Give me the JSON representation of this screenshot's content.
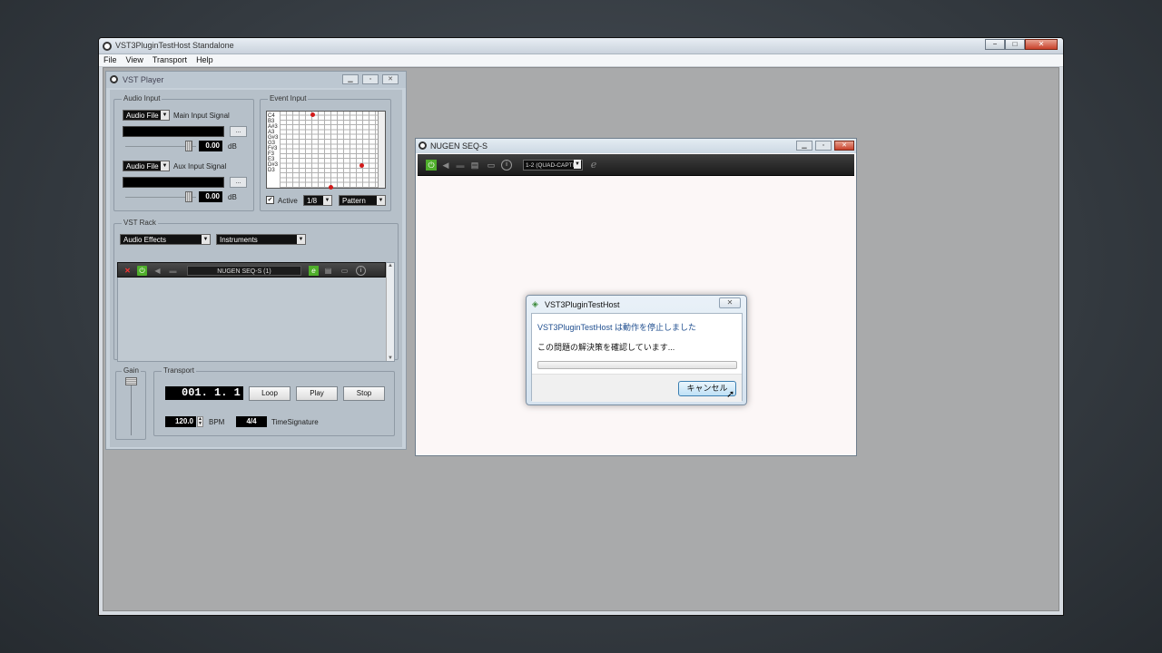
{
  "main_window": {
    "title": "VST3PluginTestHost Standalone",
    "buttons": {
      "minimize": "−",
      "maximize": "□",
      "close": "✕"
    },
    "menu": [
      "File",
      "View",
      "Transport",
      "Help"
    ]
  },
  "vst_player": {
    "title": "VST Player",
    "audio_input": {
      "label": "Audio Input",
      "main": {
        "source": "Audio File",
        "label": "Main Input Signal",
        "browse": "...",
        "value": "0.00",
        "unit": "dB"
      },
      "aux": {
        "source": "Audio File",
        "label": "Aux Input Signal",
        "browse": "...",
        "value": "0.00",
        "unit": "dB"
      }
    },
    "event_input": {
      "label": "Event Input",
      "notes": [
        "C4",
        "B3",
        "A#3",
        "A3",
        "G#3",
        "G3",
        "F#3",
        "F3",
        "E3",
        "D#3",
        "D3"
      ],
      "active_label": "Active",
      "active_checked": true,
      "resolution": "1/8",
      "mode": "Pattern"
    },
    "vst_rack": {
      "label": "VST Rack",
      "effects_dropdown": "Audio Effects",
      "instruments_dropdown": "Instruments",
      "plugin_name": "NUGEN SEQ-S (1)"
    },
    "gain": {
      "label": "Gain"
    },
    "transport": {
      "label": "Transport",
      "position": "001.  1.  1",
      "loop": "Loop",
      "play": "Play",
      "stop": "Stop",
      "bpm_value": "120.0",
      "bpm_label": "BPM",
      "time_signature_value": "4/4",
      "time_signature_label": "TimeSignature"
    }
  },
  "nugen_window": {
    "title": "NUGEN SEQ-S",
    "preset": "1-2 (QUAD-CAPTI"
  },
  "dialog": {
    "title": "VST3PluginTestHost",
    "message": "VST3PluginTestHost は動作を停止しました",
    "status": "この問題の解決策を確認しています...",
    "cancel": "キャンセル"
  }
}
